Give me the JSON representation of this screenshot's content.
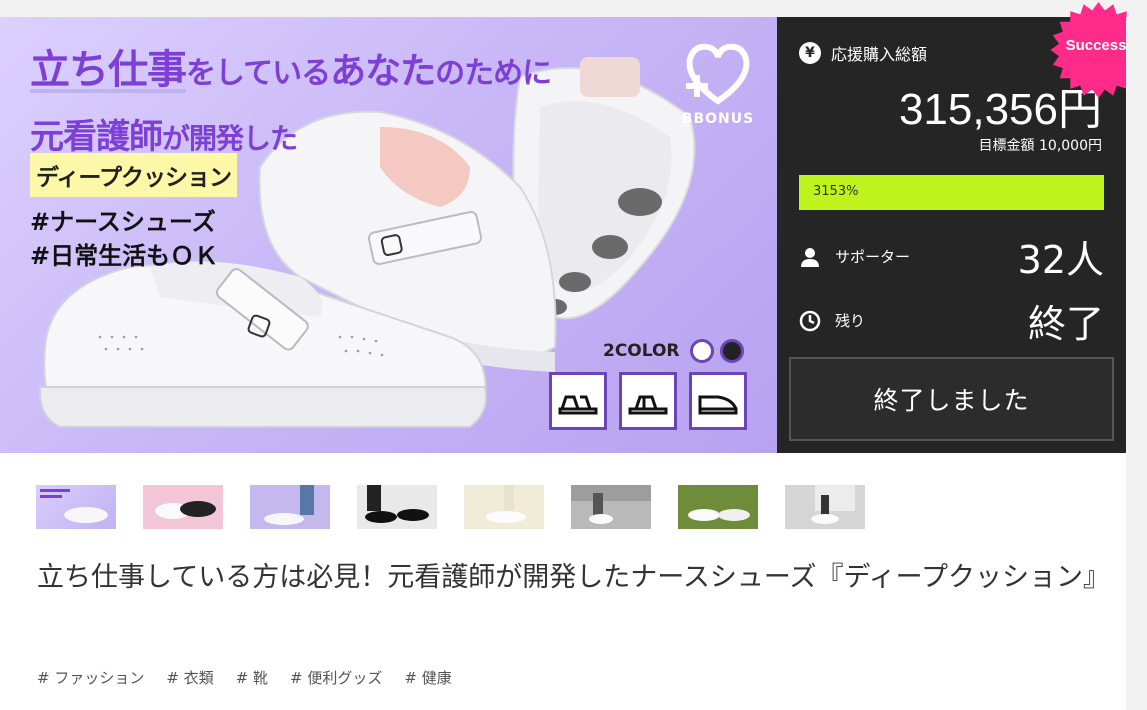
{
  "hero": {
    "line1_a": "立ち仕事",
    "line1_b": "をしている",
    "line1_c": "あなた",
    "line1_d": "のために",
    "line2_a": "元看護師",
    "line2_b": "が開発した",
    "cushion": "ディープクッション",
    "hashtag1": "#ナースシューズ",
    "hashtag2": "#日常生活もＯＫ",
    "brand": "BBONUS",
    "two_color": "2COLOR",
    "colors": [
      "#ffffff",
      "#222222"
    ]
  },
  "panel": {
    "total_label": "応援購入総額",
    "amount": "315,356円",
    "goal": "目標金額 10,000円",
    "progress_text": "3153%",
    "progress_fraction": 1.0,
    "supporters_label": "サポーター",
    "supporters_value": "32人",
    "remaining_label": "残り",
    "remaining_value": "終了",
    "ended_button": "終了しました",
    "badge": "Success!",
    "accent": "#bef31b",
    "badge_color": "#ff2a8a"
  },
  "title": "立ち仕事している方は必見！元看護師が開発したナースシューズ『ディープクッション』",
  "tags": [
    "# ファッション",
    "# 衣類",
    "# 靴",
    "# 便利グッズ",
    "# 健康"
  ]
}
